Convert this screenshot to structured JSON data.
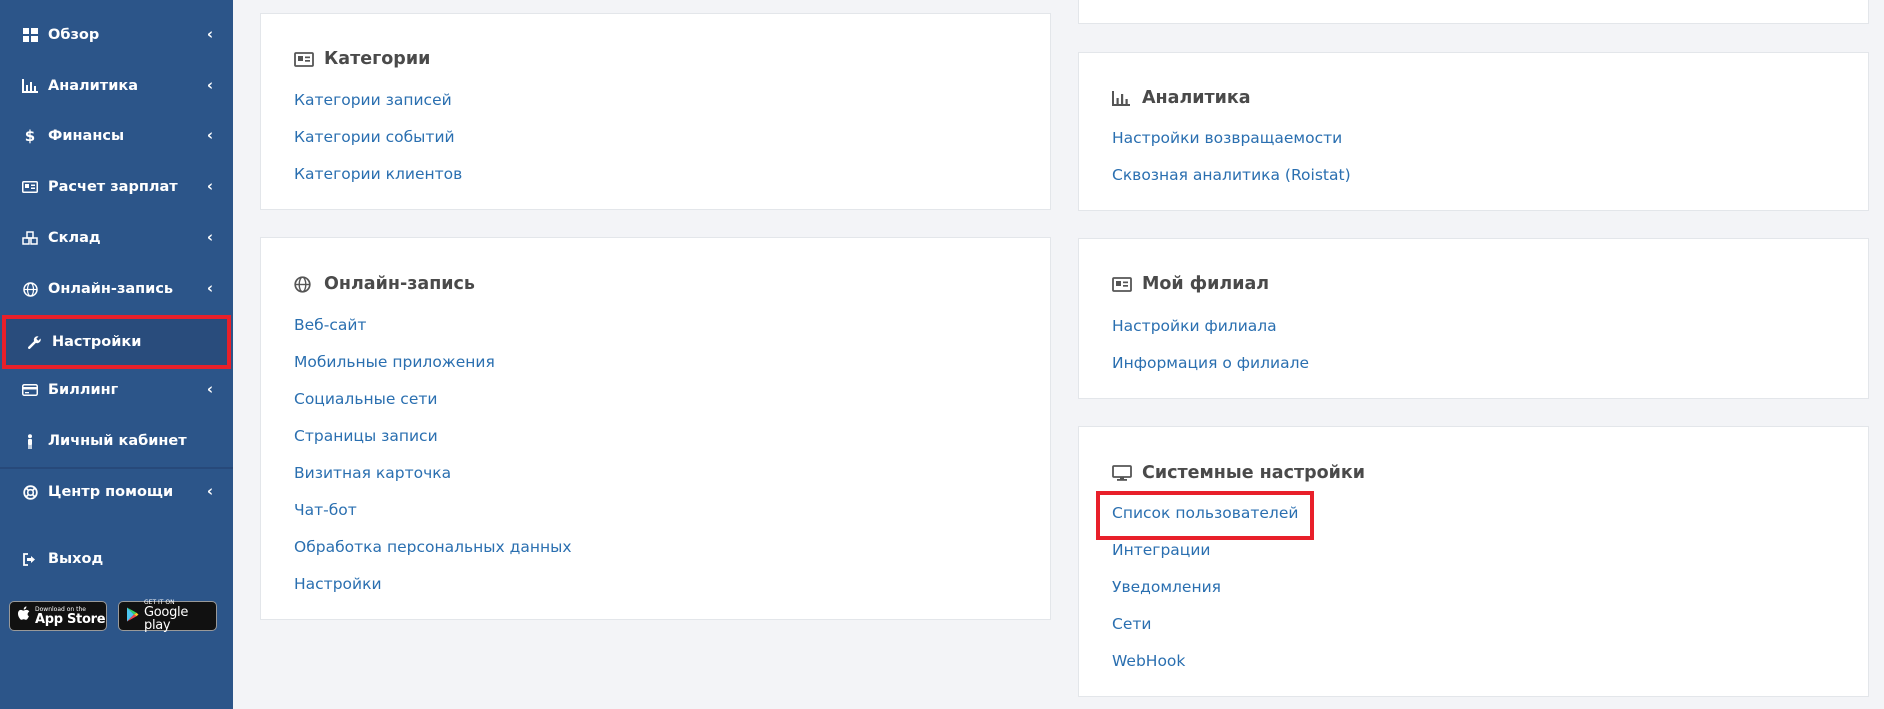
{
  "sidebar": {
    "items": [
      {
        "label": "Обзор",
        "icon": "dashboard-icon",
        "has_submenu": true
      },
      {
        "label": "Аналитика",
        "icon": "chart-icon",
        "has_submenu": true
      },
      {
        "label": "Финансы",
        "icon": "dollar-icon",
        "has_submenu": true
      },
      {
        "label": "Расчет зарплат",
        "icon": "id-card-icon",
        "has_submenu": true
      },
      {
        "label": "Склад",
        "icon": "cubes-icon",
        "has_submenu": true
      },
      {
        "label": "Онлайн-запись",
        "icon": "globe-icon",
        "has_submenu": true
      },
      {
        "label": "Настройки",
        "icon": "wrench-icon",
        "has_submenu": false,
        "active": true
      },
      {
        "label": "Биллинг",
        "icon": "credit-card-icon",
        "has_submenu": true
      },
      {
        "label": "Личный кабинет",
        "icon": "person-icon",
        "has_submenu": false
      },
      {
        "label": "Центр помощи",
        "icon": "lifebuoy-icon",
        "has_submenu": true
      },
      {
        "label": "Выход",
        "icon": "sign-out-icon",
        "has_submenu": false
      }
    ],
    "chevron": "‹",
    "badges": {
      "appstore_small": "Download on the",
      "appstore_big": "App Store",
      "googleplay_small": "GET IT ON",
      "googleplay_big": "Google play"
    }
  },
  "cards": {
    "categories": {
      "title": "Категории",
      "icon": "id-card-icon",
      "links": [
        "Категории записей",
        "Категории событий",
        "Категории клиентов"
      ]
    },
    "online_booking": {
      "title": "Онлайн-запись",
      "icon": "globe-icon",
      "links": [
        "Веб-сайт",
        "Мобильные приложения",
        "Социальные сети",
        "Страницы записи",
        "Визитная карточка",
        "Чат-бот",
        "Обработка персональных данных",
        "Настройки"
      ]
    },
    "analytics": {
      "title": "Аналитика",
      "icon": "chart-icon",
      "links": [
        "Настройки возвращаемости",
        "Сквозная аналитика (Roistat)"
      ]
    },
    "my_branch": {
      "title": "Мой филиал",
      "icon": "id-card-icon",
      "links": [
        "Настройки филиала",
        "Информация о филиале"
      ]
    },
    "system": {
      "title": "Системные настройки",
      "icon": "desktop-icon",
      "links": [
        "Список пользователей",
        "Интеграции",
        "Уведомления",
        "Сети",
        "WebHook"
      ]
    }
  },
  "colors": {
    "sidebar_bg": "#2c5589",
    "link": "#2a6fb0",
    "highlight": "#e8202a",
    "page_bg": "#f3f4f7"
  }
}
